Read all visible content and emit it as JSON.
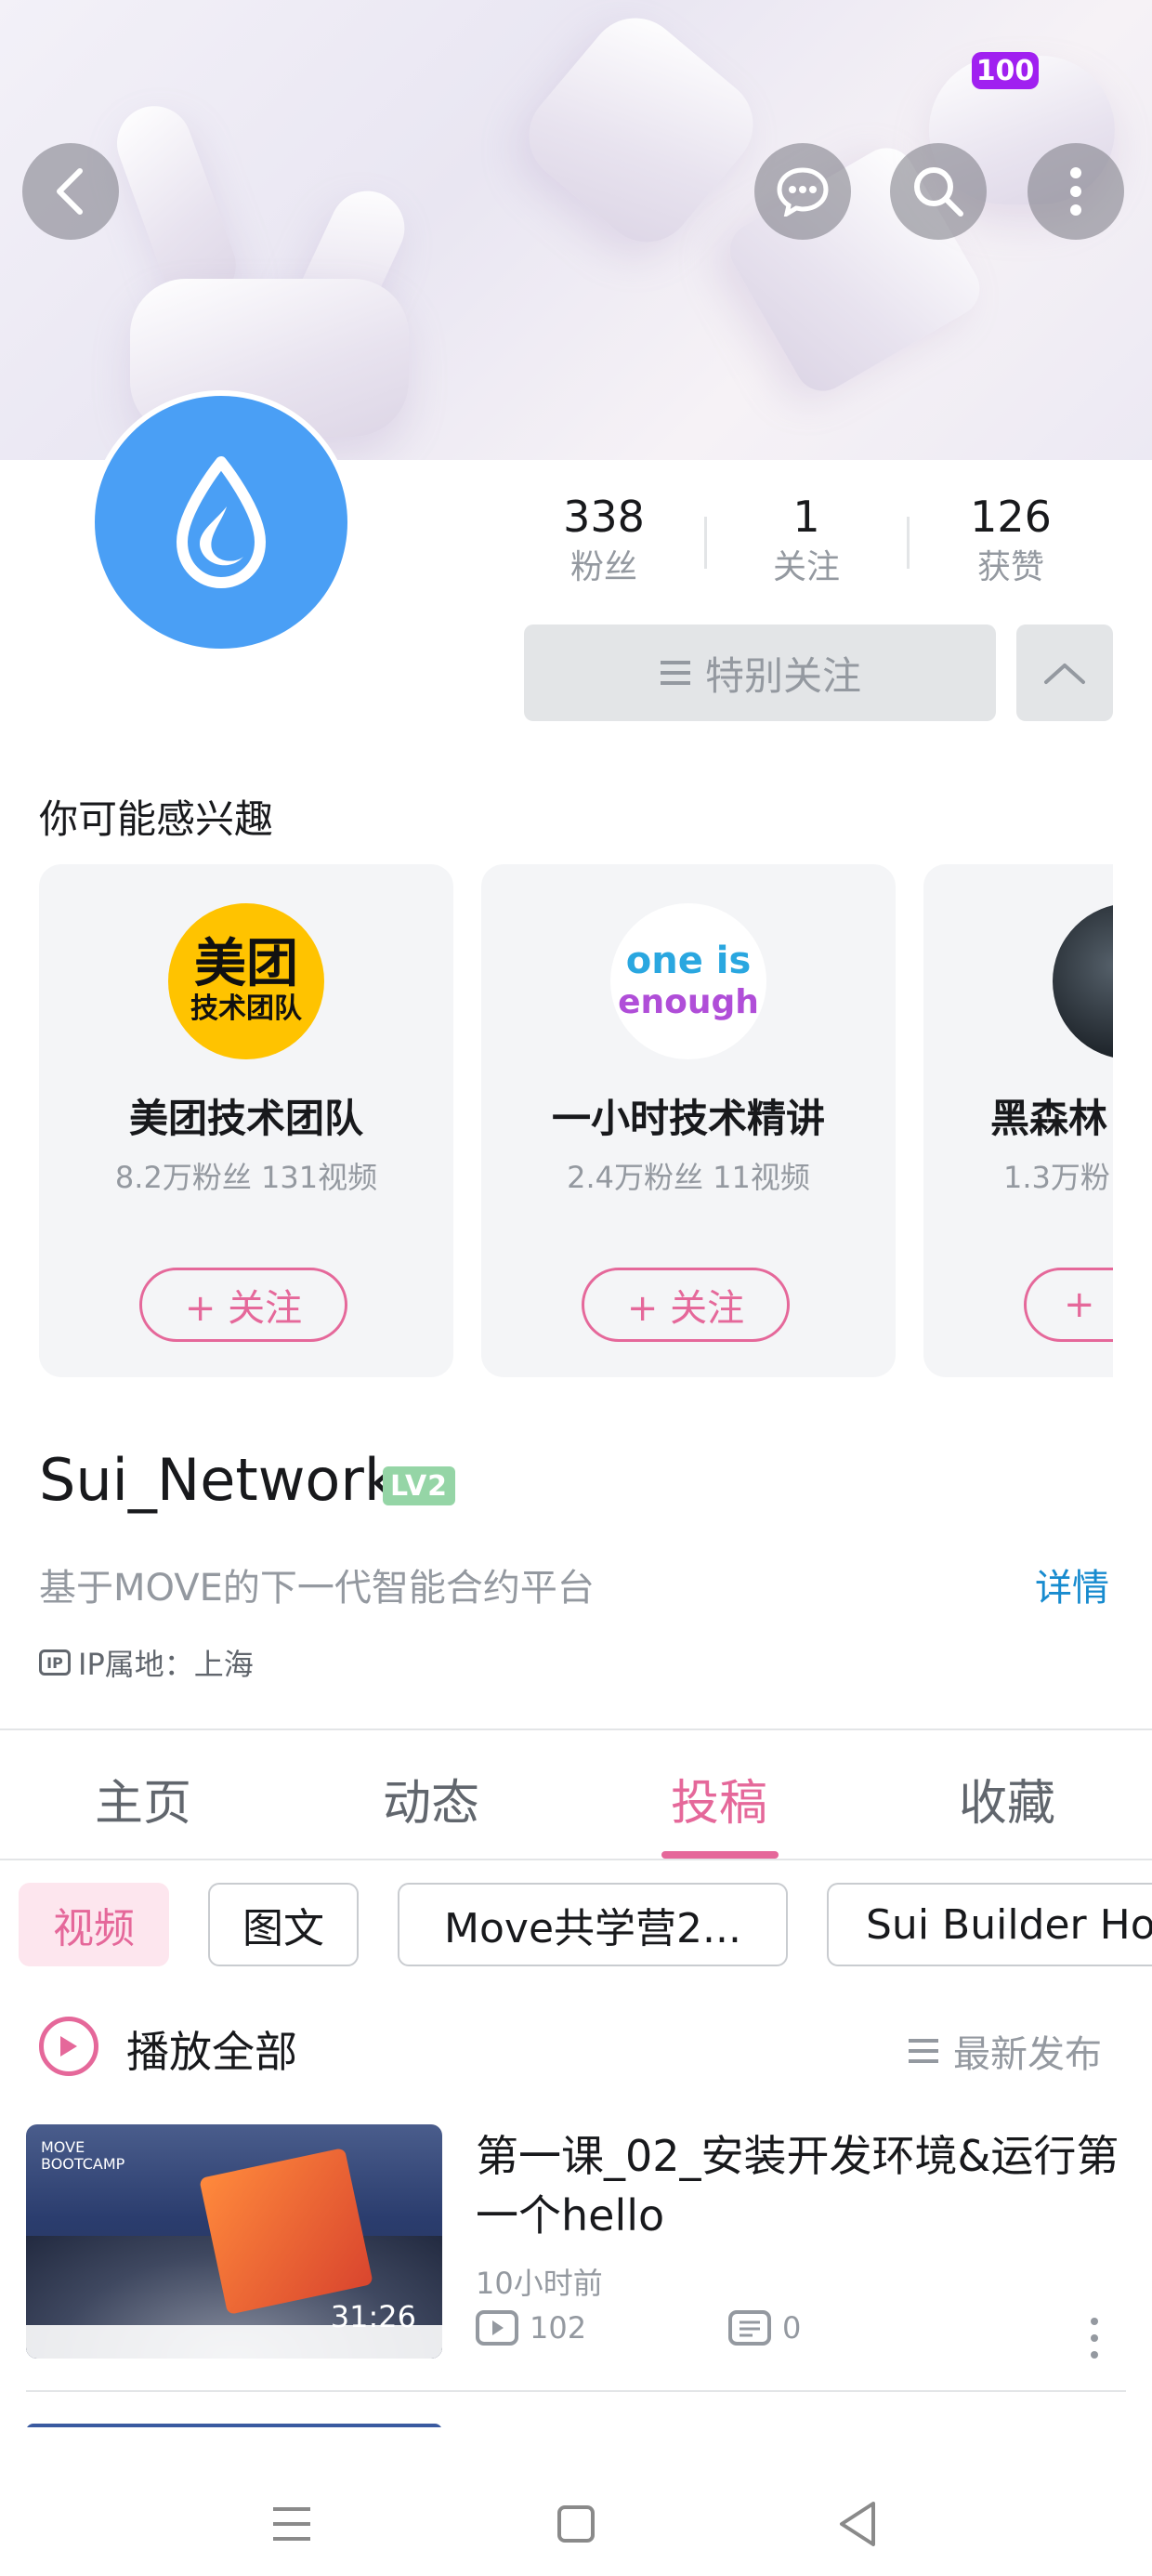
{
  "status": {
    "battery": "100"
  },
  "profile": {
    "stats": [
      {
        "num": "338",
        "label": "粉丝"
      },
      {
        "num": "1",
        "label": "关注"
      },
      {
        "num": "126",
        "label": "获赞"
      }
    ],
    "special_follow": "特别关注",
    "username": "Sui_Network",
    "level": "LV2",
    "bio": "基于MOVE的下一代智能合约平台",
    "detail_link": "详情",
    "ip": "IP属地：上海",
    "avatar_color": "#4a9ff5"
  },
  "recommend": {
    "title": "你可能感兴趣",
    "cards": [
      {
        "logo_line1": "美团",
        "logo_line2": "技术团队",
        "name": "美团技术团队",
        "meta": "8.2万粉丝 131视频",
        "follow": "+ 关注"
      },
      {
        "logo_line1": "one is",
        "logo_line2": "enough",
        "name": "一小时技术精讲",
        "meta": "2.4万粉丝 11视频",
        "follow": "+ 关注"
      },
      {
        "name": "黑森林",
        "meta": "1.3万粉",
        "follow": "+"
      }
    ]
  },
  "tabs": [
    "主页",
    "动态",
    "投稿",
    "收藏"
  ],
  "active_tab": "投稿",
  "chips": [
    "视频",
    "图文",
    "Move共学营2...",
    "Sui Builder Ho"
  ],
  "list": {
    "play_all": "播放全部",
    "sort": "最新发布"
  },
  "video": {
    "title": "第一课_02_安装开发环境&运行第一个hello",
    "time": "10小时前",
    "views": "102",
    "comments": "0",
    "duration": "31:26",
    "thumb_caption": "MOVE BOOTCAMP"
  },
  "colors": {
    "accent": "#e5689a",
    "link": "#178bcf"
  }
}
